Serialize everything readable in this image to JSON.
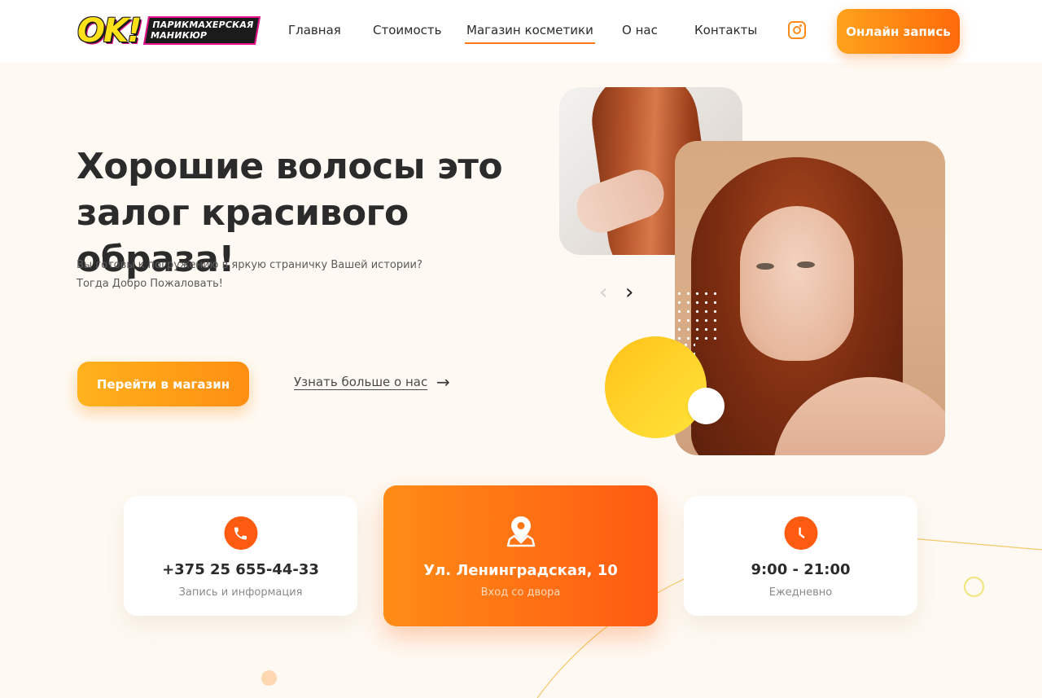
{
  "header": {
    "logo": {
      "big": "OK!",
      "line1": "ПАРИКМАХЕРСКАЯ",
      "line2": "МАНИКЮР"
    },
    "nav": [
      {
        "label": "Главная",
        "active": false
      },
      {
        "label": "Стоимость",
        "active": false
      },
      {
        "label": "Магазин косметики",
        "active": true
      },
      {
        "label": "О нас",
        "active": false
      },
      {
        "label": "Контакты",
        "active": false
      }
    ],
    "social_icon": "instagram-icon",
    "cta_label": "Онлайн запись"
  },
  "hero": {
    "title_line1": "Хорошие волосы это",
    "title_line2": "залог красивого образа!",
    "subtitle_line1": "Вы готовы к погружению в яркую страничку Вашей истории?",
    "subtitle_line2": "Тогда Добро Пожаловать!",
    "shop_button": "Перейти в магазин",
    "more_link": "Узнать больше о нас",
    "slider_prev": "‹",
    "slider_next": "›"
  },
  "info": {
    "phone": {
      "value": "+375 25 655-44-33",
      "label": "Запись и информация",
      "icon": "phone-icon"
    },
    "address": {
      "value": "Ул. Ленинградская, 10",
      "label": "Вход со двора",
      "icon": "location-pin-icon"
    },
    "hours": {
      "value": "9:00 - 21:00",
      "label": "Ежедневно",
      "icon": "clock-icon"
    }
  },
  "colors": {
    "accent": "#ff6a0a",
    "accent_light": "#ffa21c",
    "background": "#fefaf3"
  }
}
